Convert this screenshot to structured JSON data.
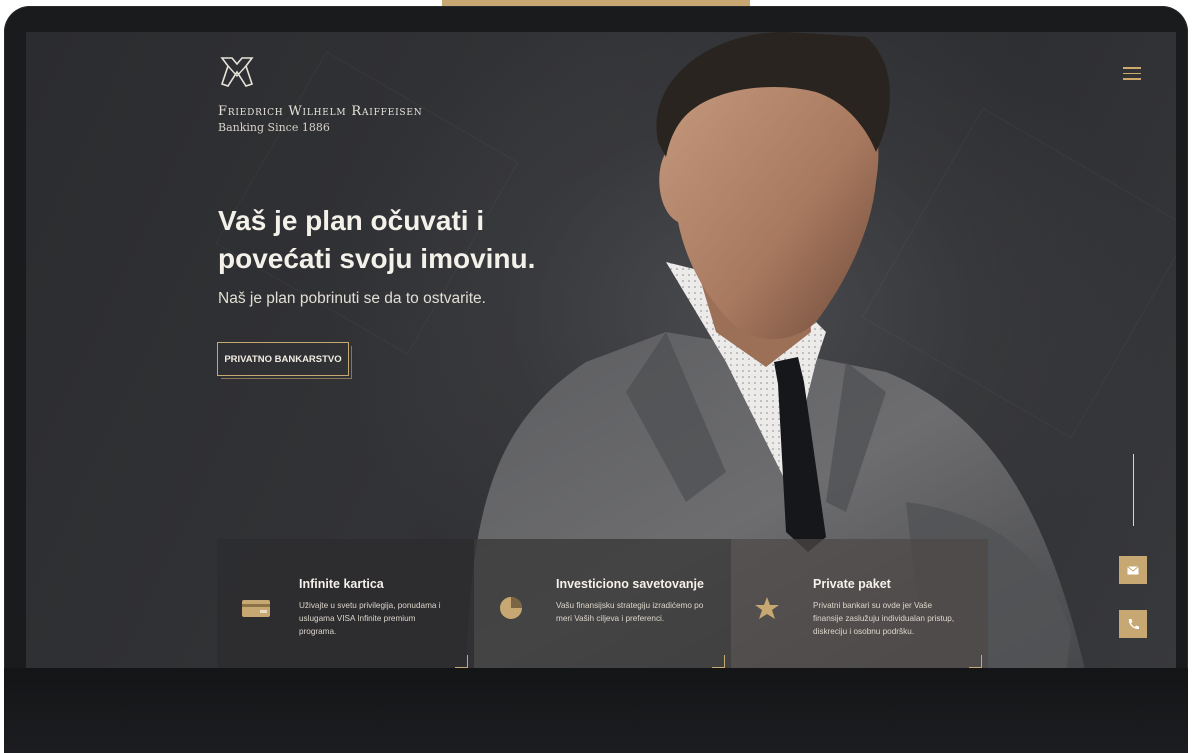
{
  "brand": {
    "name": "Friedrich Wilhelm Raiffeisen",
    "tagline": "Banking Since 1886",
    "logo_icon": "crossed-horse-heads-icon"
  },
  "hero": {
    "headline": "Vaš je plan očuvati i povećati svoju imovinu.",
    "subline": "Naš je plan pobrinuti se da to ostvarite.",
    "cta_label": "PRIVATNO BANKARSTVO"
  },
  "header": {
    "menu_icon": "hamburger-icon"
  },
  "side_actions": [
    {
      "icon": "mail-icon"
    },
    {
      "icon": "phone-icon"
    }
  ],
  "cards": [
    {
      "icon": "credit-card-icon",
      "title": "Infinite kartica",
      "text": "Uživajte u svetu privilegija, ponudama i uslugama VISA Infinite premium programa."
    },
    {
      "icon": "pie-chart-icon",
      "title": "Investiciono savetovanje",
      "text": "Vašu finansijsku strategiju izradićemo po meri Vaših ciljeva i preferenci."
    },
    {
      "icon": "star-icon",
      "title": "Private paket",
      "text": "Privatni bankari su ovde jer Vaše finansije zaslužuju individualan pristup, diskreciju i osobnu podršku."
    }
  ],
  "colors": {
    "accent": "#c8a872",
    "background": "#2e2f32",
    "text": "#f4f1ea"
  }
}
